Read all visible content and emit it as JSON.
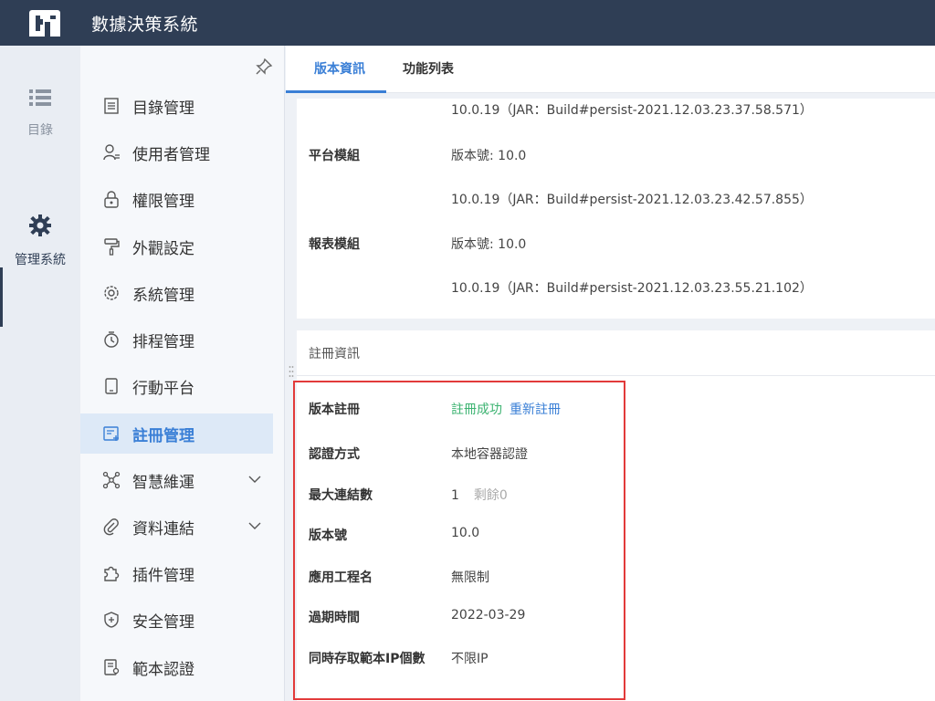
{
  "app": {
    "title": "數據決策系統"
  },
  "rail": {
    "items": [
      {
        "label": "目錄",
        "icon": "list-icon"
      },
      {
        "label": "管理系統",
        "icon": "gear-icon"
      }
    ]
  },
  "menu": {
    "items": [
      {
        "label": "目錄管理",
        "icon": "catalog-icon"
      },
      {
        "label": "使用者管理",
        "icon": "user-icon"
      },
      {
        "label": "權限管理",
        "icon": "lock-icon"
      },
      {
        "label": "外觀設定",
        "icon": "paint-roller-icon"
      },
      {
        "label": "系統管理",
        "icon": "settings-icon"
      },
      {
        "label": "排程管理",
        "icon": "timer-icon"
      },
      {
        "label": "行動平台",
        "icon": "tablet-icon"
      },
      {
        "label": "註冊管理",
        "icon": "register-icon",
        "active": true
      },
      {
        "label": "智慧維運",
        "icon": "network-icon",
        "expandable": true
      },
      {
        "label": "資料連結",
        "icon": "link-icon",
        "expandable": true
      },
      {
        "label": "插件管理",
        "icon": "puzzle-icon"
      },
      {
        "label": "安全管理",
        "icon": "shield-icon"
      },
      {
        "label": "範本認證",
        "icon": "certificate-icon"
      }
    ]
  },
  "tabs": [
    {
      "label": "版本資訊",
      "active": true
    },
    {
      "label": "功能列表"
    }
  ],
  "version_card": {
    "top_line": "10.0.19（JAR：Build#persist-2021.12.03.23.37.58.571）",
    "modules": [
      {
        "label": "平台模組",
        "version": "版本號: 10.0",
        "build": "10.0.19（JAR：Build#persist-2021.12.03.23.42.57.855）"
      },
      {
        "label": "報表模組",
        "version": "版本號: 10.0",
        "build": "10.0.19（JAR：Build#persist-2021.12.03.23.55.21.102）"
      }
    ]
  },
  "registration": {
    "header": "註冊資訊",
    "status_label": "版本註冊",
    "status_value": "註冊成功",
    "reregister": "重新註冊",
    "status_color": "#3cb371",
    "link_color": "#3a7fd6",
    "rows": [
      {
        "label": "認證方式",
        "value": "本地容器認證"
      },
      {
        "label": "最大連結數",
        "value": "1",
        "extra": "剩餘0"
      },
      {
        "label": "版本號",
        "value": "10.0"
      },
      {
        "label": "應用工程名",
        "value": "無限制"
      },
      {
        "label": "過期時間",
        "value": "2022-03-29"
      },
      {
        "label": "同時存取範本IP個數",
        "value": "不限IP"
      }
    ]
  },
  "colors": {
    "topbar": "#2f3e55",
    "accent": "#3a7fd6",
    "highlight": "#e23a3a"
  }
}
